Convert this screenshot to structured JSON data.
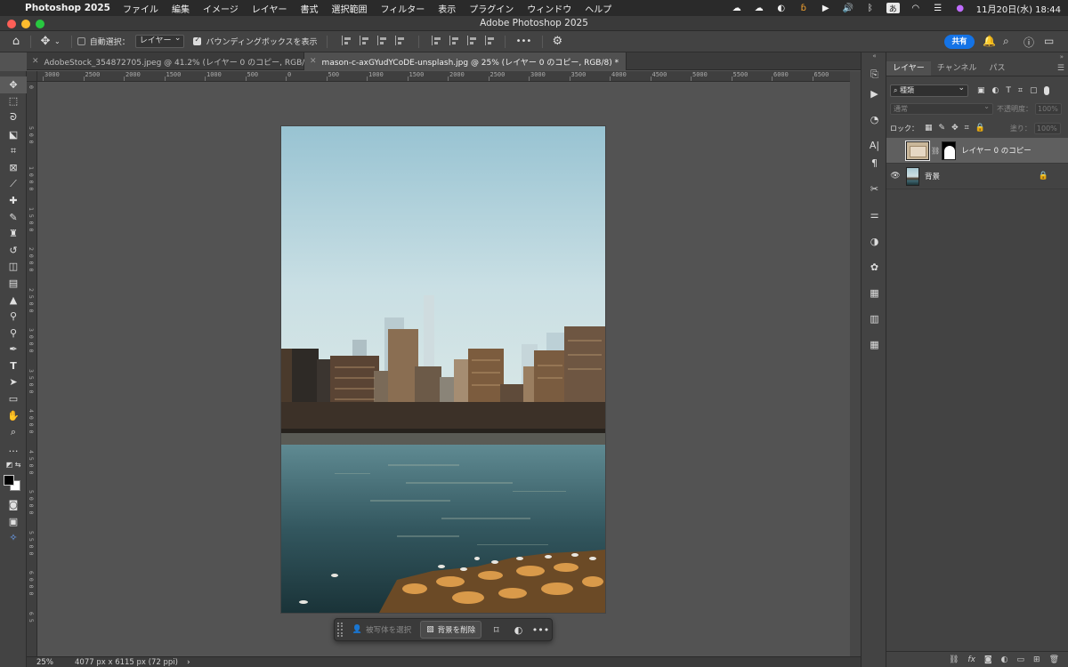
{
  "menubar": {
    "app_name": "Photoshop 2025",
    "menus": [
      "ファイル",
      "編集",
      "イメージ",
      "レイヤー",
      "書式",
      "選択範囲",
      "フィルター",
      "表示",
      "プラグイン",
      "ウィンドウ",
      "ヘルプ"
    ],
    "ime_label": "あ",
    "clock": "11月20日(水)  18:44"
  },
  "window": {
    "title": "Adobe Photoshop 2025"
  },
  "options_bar": {
    "auto_select_label": "自動選択：",
    "auto_select_target": "レイヤー",
    "bounding_box_label": "バウンディングボックスを表示",
    "more_label": "•••",
    "share_label": "共有"
  },
  "tabs": [
    {
      "label": "AdobeStock_354872705.jpeg @ 41.2% (レイヤー 0 のコピー, RGB/8#) *",
      "active": false
    },
    {
      "label": "mason-c-axGYudYCoDE-unsplash.jpg @ 25% (レイヤー 0 のコピー, RGB/8) *",
      "active": true
    }
  ],
  "ruler": {
    "top_labels": [
      "3000",
      "2500",
      "2000",
      "1500",
      "1000",
      "500",
      "0",
      "500",
      "1000",
      "1500",
      "2000",
      "2500",
      "3000",
      "3500",
      "4000",
      "4500",
      "5000",
      "5500",
      "6000",
      "6500",
      "700"
    ],
    "left_labels": [
      "0",
      "5 0 0",
      "1 0 0 0",
      "1 5 0 0",
      "2 0 0 0",
      "2 5 0 0",
      "3 0 0 0",
      "3 5 0 0",
      "4 0 0 0",
      "4 5 0 0",
      "5 0 0 0",
      "5 5 0 0",
      "6 0 0 0",
      "6 5"
    ]
  },
  "context_bar": {
    "select_subject": "被写体を選択",
    "remove_background": "背景を削除",
    "more": "•••"
  },
  "status_bar": {
    "zoom": "25%",
    "document_info": "4077 px x 6115 px (72 ppi)",
    "arrow": "›"
  },
  "layers_panel": {
    "tabs": [
      "レイヤー",
      "チャンネル",
      "パス"
    ],
    "kind_filter": "種類",
    "blend_mode": "通常",
    "opacity_label": "不透明度：",
    "opacity_value": "100%",
    "lock_label": "ロック：",
    "fill_label": "塗り：",
    "fill_value": "100%",
    "layers": [
      {
        "name": "レイヤー 0 のコピー",
        "visible": false,
        "selected": true,
        "has_mask": true,
        "locked": false
      },
      {
        "name": "背景",
        "visible": true,
        "selected": false,
        "has_mask": false,
        "locked": true
      }
    ],
    "footer_fx": "fx"
  },
  "colors": {
    "accent": "#1473e6",
    "app_bg": "#535353",
    "panel_bg": "#434343"
  }
}
